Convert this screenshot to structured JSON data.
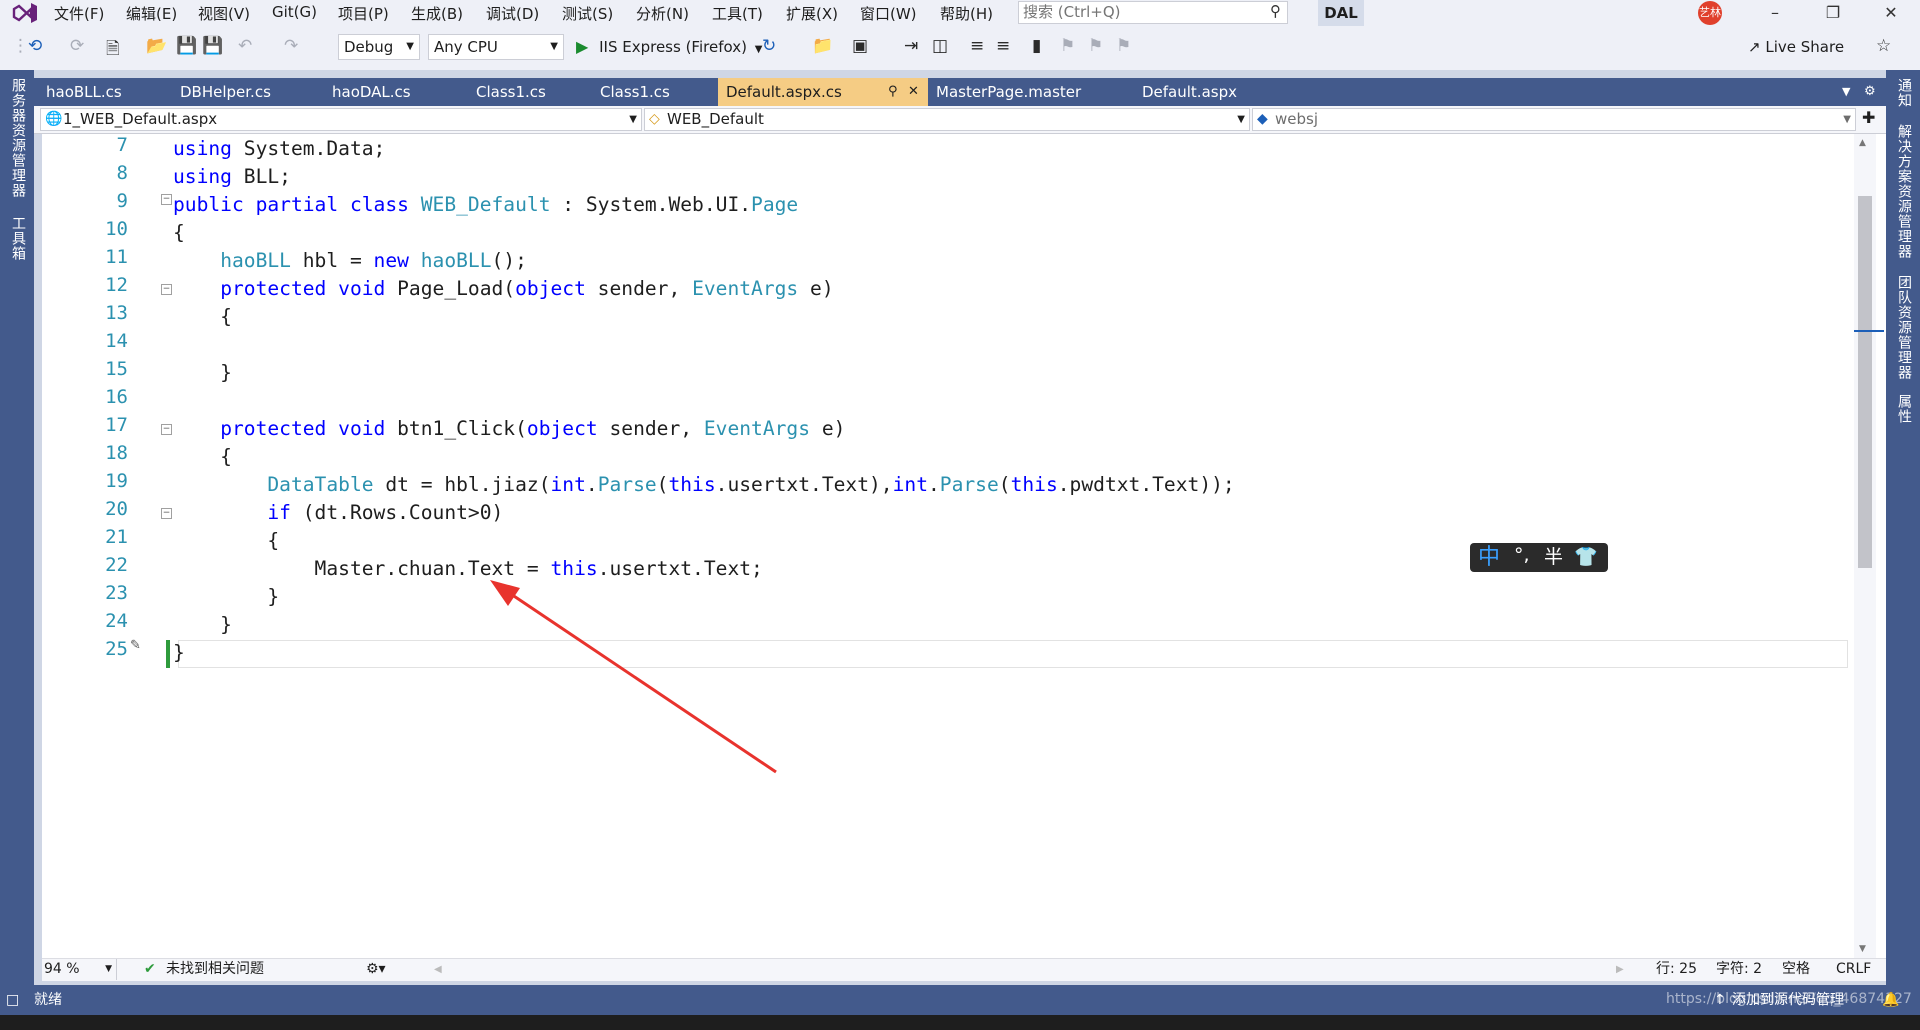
{
  "menu": {
    "items": [
      "文件(F)",
      "编辑(E)",
      "视图(V)",
      "Git(G)",
      "项目(P)",
      "生成(B)",
      "调试(D)",
      "测试(S)",
      "分析(N)",
      "工具(T)",
      "扩展(X)",
      "窗口(W)",
      "帮助(H)"
    ],
    "search_placeholder": "搜索 (Ctrl+Q)",
    "solution_name": "DAL",
    "avatar_text": "艺林"
  },
  "toolbar": {
    "config": "Debug",
    "platform": "Any CPU",
    "run_label": "IIS Express (Firefox)",
    "live_share": "Live Share"
  },
  "left_rail": {
    "server_explorer": "服务器资源管理器",
    "toolbox": "工具箱"
  },
  "right_rail": {
    "notifications": "通知",
    "solution_explorer": "解决方案资源管理器",
    "team_explorer": "团队资源管理器",
    "properties": "属性"
  },
  "tabs": [
    "haoBLL.cs",
    "DBHelper.cs",
    "haoDAL.cs",
    "Class1.cs",
    "Class1.cs",
    "Default.aspx.cs",
    "MasterPage.master",
    "Default.aspx"
  ],
  "active_tab": "Default.aspx.cs",
  "navbar": {
    "project": "1_WEB_Default.aspx",
    "class": "WEB_Default",
    "member": "websj"
  },
  "code": {
    "line_numbers": [
      "7",
      "8",
      "9",
      "10",
      "11",
      "12",
      "13",
      "14",
      "15",
      "16",
      "17",
      "18",
      "19",
      "20",
      "21",
      "22",
      "23",
      "24",
      "25"
    ]
  },
  "ime": {
    "mode": "中",
    "punct": "°,",
    "width": "半"
  },
  "editor_status": {
    "zoom": "94 %",
    "issues": "未找到相关问题",
    "line": "行: 25",
    "char": "字符: 2",
    "whitespace": "空格",
    "eol": "CRLF"
  },
  "statusbar": {
    "ready": "就绪",
    "source_control": "添加到源代码管理",
    "watermark": "https://blog.csdn.net/qq_46874327"
  }
}
